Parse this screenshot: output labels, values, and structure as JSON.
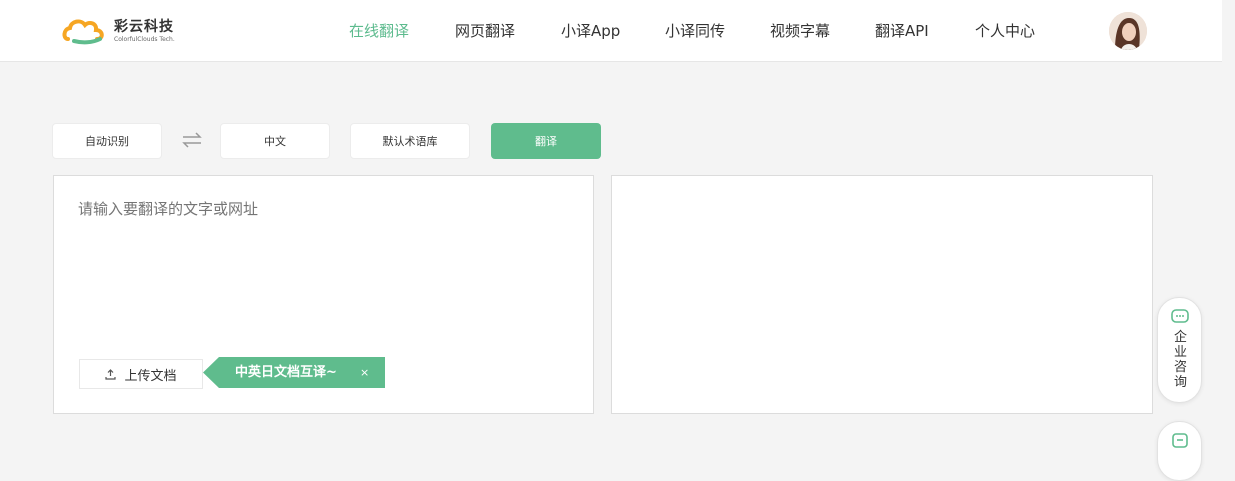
{
  "brand": {
    "name": "彩云科技",
    "tagline": "ColorfulClouds Tech.",
    "accent": "#5fbc8d",
    "logo_orange": "#f6a623",
    "logo_green": "#5fbc8d"
  },
  "nav": {
    "items": [
      {
        "label": "在线翻译",
        "active": true
      },
      {
        "label": "网页翻译",
        "active": false
      },
      {
        "label": "小译App",
        "active": false
      },
      {
        "label": "小译同传",
        "active": false
      },
      {
        "label": "视频字幕",
        "active": false
      },
      {
        "label": "翻译API",
        "active": false
      },
      {
        "label": "个人中心",
        "active": false
      }
    ],
    "avatar_icon": "user-avatar"
  },
  "toolbar": {
    "source_lang": "自动识别",
    "swap_icon": "swap-arrows-icon",
    "target_lang": "中文",
    "glossary": "默认术语库",
    "translate": "翻译"
  },
  "source_panel": {
    "placeholder": "请输入要翻译的文字或网址",
    "upload_label": "上传文档",
    "upload_icon": "upload-icon",
    "lang_tag": "中英日文档互译~",
    "lang_tag_close": "×"
  },
  "side": {
    "consult_icon": "chat-bubble-icon",
    "consult_label": "企业咨询"
  }
}
